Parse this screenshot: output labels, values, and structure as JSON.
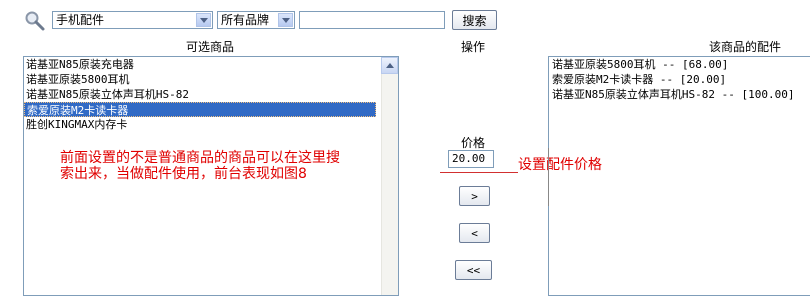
{
  "search": {
    "category_value": "手机配件",
    "brand_value": "所有品牌",
    "keyword_value": "",
    "search_button": "搜索"
  },
  "headers": {
    "available": "可选商品",
    "operation": "操作",
    "linked": "该商品的配件"
  },
  "available_goods": [
    "诺基亚N85原装充电器",
    "诺基亚原装5800耳机",
    "诺基亚N85原装立体声耳机HS-82",
    "索爱原装M2卡读卡器",
    "胜创KINGMAX内存卡"
  ],
  "selected_index": 3,
  "price": {
    "label": "价格",
    "value": "20.00"
  },
  "buttons": {
    "add": ">",
    "remove": "<",
    "remove_all": "<<"
  },
  "linked_goods": [
    "诺基亚原装5800耳机 -- [68.00]",
    "索爱原装M2卡读卡器 -- [20.00]",
    "诺基亚N85原装立体声耳机HS-82 -- [100.00]"
  ],
  "annotations": {
    "main": "前面设置的不是普通商品的商品可以在这里搜索出来，当做配件使用，前台表现如图8",
    "price": "设置配件价格"
  },
  "colors": {
    "selection": "#316ac5",
    "annotation": "#e00000",
    "border": "#7f9db9"
  }
}
